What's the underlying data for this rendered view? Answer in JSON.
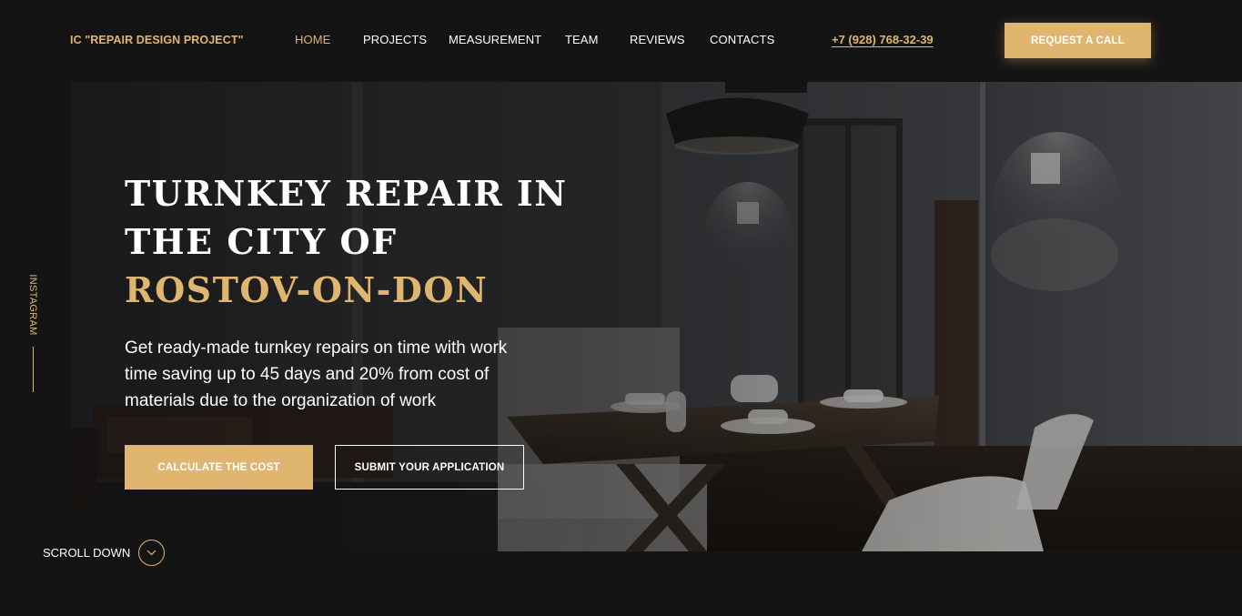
{
  "header": {
    "logo": "IC \"REPAIR DESIGN PROJECT\"",
    "nav": [
      "HOME",
      "PROJECTS",
      "MEASUREMENT",
      "TEAM",
      "REVIEWS",
      "CONTACTS"
    ],
    "active_nav": "HOME",
    "phone": "+7 (928) 768-32-39",
    "request_button": "REQUEST A CALL"
  },
  "hero": {
    "title_line1": "TURNKEY REPAIR IN",
    "title_line2": "THE CITY OF",
    "title_accent": "ROSTOV-ON-DON",
    "subtitle": "Get ready-made turnkey repairs on time with work time saving up to 45 days and 20% from cost of materials due to the organization of work",
    "calc_button": "CALCULATE THE COST",
    "submit_button": "SUBMIT YOUR APPLICATION"
  },
  "side": {
    "instagram": "INSTAGRAM"
  },
  "scroll": {
    "label": "SCROLL DOWN"
  },
  "colors": {
    "accent": "#e0b56f",
    "background": "#141414",
    "text": "#ffffff"
  },
  "icons": {
    "scroll": "chevron-down-icon"
  }
}
